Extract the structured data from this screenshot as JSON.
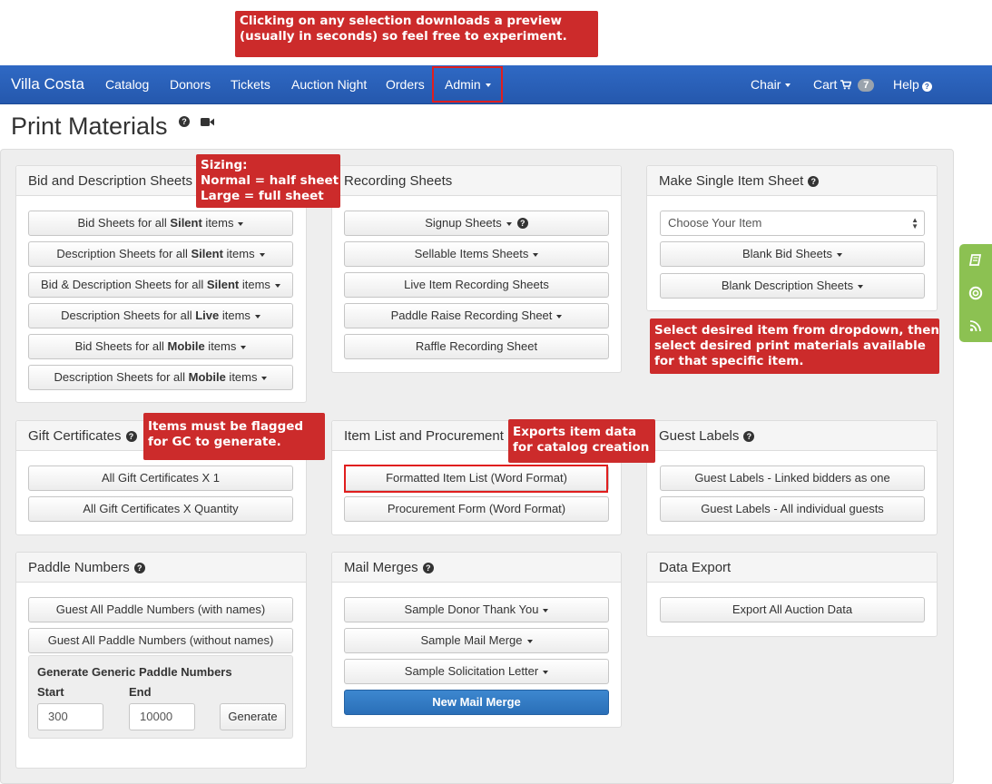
{
  "annotations": {
    "top": [
      "Clicking on any selection downloads a preview",
      "(usually in seconds) so feel free to experiment."
    ],
    "sizing": [
      "Sizing:",
      "Normal = half sheet",
      "Large = full sheet"
    ],
    "single_item": [
      "Select desired item from dropdown, then",
      "select desired print materials available",
      "for that specific item."
    ],
    "gift": [
      "Items must be flagged",
      "for GC to generate."
    ],
    "exports": [
      "Exports item data",
      "for catalog creation"
    ]
  },
  "navbar": {
    "brand": "Villa Costa",
    "items": [
      "Catalog",
      "Donors",
      "Tickets",
      "Auction Night",
      "Orders"
    ],
    "admin": "Admin",
    "chair": "Chair",
    "cart": "Cart",
    "cart_count": "7",
    "help": "Help"
  },
  "page": {
    "title": "Print Materials"
  },
  "bid_desc": {
    "title": "Bid and Description Sheets",
    "buttons": [
      {
        "pre": "Bid Sheets for all ",
        "bold": "Silent",
        "post": " items"
      },
      {
        "pre": "Description Sheets for all ",
        "bold": "Silent",
        "post": " items"
      },
      {
        "pre": "Bid & Description Sheets for all ",
        "bold": "Silent",
        "post": " items"
      },
      {
        "pre": "Description Sheets for all ",
        "bold": "Live",
        "post": " items"
      },
      {
        "pre": "Bid Sheets for all ",
        "bold": "Mobile",
        "post": " items"
      },
      {
        "pre": "Description Sheets for all ",
        "bold": "Mobile",
        "post": " items"
      }
    ]
  },
  "recording": {
    "title": "Recording Sheets",
    "buttons": [
      "Signup Sheets",
      "Sellable Items Sheets",
      "Live Item Recording Sheets",
      "Paddle Raise Recording Sheet",
      "Raffle Recording Sheet"
    ]
  },
  "single_item": {
    "title": "Make Single Item Sheet",
    "select_value": "Choose Your Item",
    "buttons": [
      "Blank Bid Sheets",
      "Blank Description Sheets"
    ]
  },
  "gift": {
    "title": "Gift Certificates",
    "buttons": [
      "All Gift Certificates X 1",
      "All Gift Certificates X Quantity"
    ]
  },
  "item_list": {
    "title": "Item List and Procurement",
    "buttons": [
      "Formatted Item List (Word Format)",
      "Procurement Form (Word Format)"
    ]
  },
  "guest_labels": {
    "title": "Guest Labels",
    "buttons": [
      "Guest Labels - Linked bidders as one",
      "Guest Labels - All individual guests"
    ]
  },
  "paddle": {
    "title": "Paddle Numbers",
    "buttons": [
      "Guest All Paddle Numbers (with names)",
      "Guest All Paddle Numbers (without names)"
    ],
    "generate_title": "Generate Generic Paddle Numbers",
    "start_label": "Start",
    "end_label": "End",
    "start_value": "300",
    "end_value": "10000",
    "generate_button": "Generate"
  },
  "mail_merges": {
    "title": "Mail Merges",
    "buttons": [
      "Sample Donor Thank You",
      "Sample Mail Merge",
      "Sample Solicitation Letter"
    ],
    "new_button": "New Mail Merge"
  },
  "data_export": {
    "title": "Data Export",
    "buttons": [
      "Export All Auction Data"
    ]
  },
  "colors": {
    "navbar": "#2558ad",
    "annotation": "#cc2b2b",
    "primary": "#2a6fb8",
    "side_widget": "#8cc152"
  }
}
